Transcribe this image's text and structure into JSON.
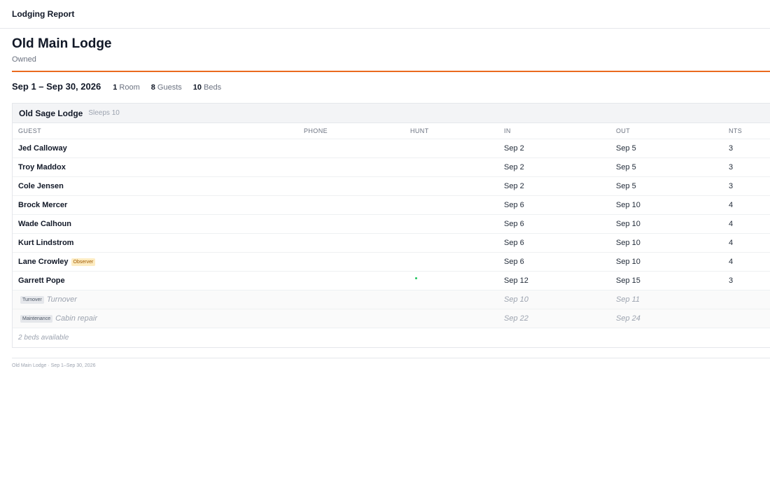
{
  "app": {
    "title": "Lodging Report"
  },
  "lodge": {
    "name": "Old Main Lodge",
    "ownership": "Owned"
  },
  "summary": {
    "dates": "Sep 1 – Sep 30, 2026",
    "rooms_count": "1",
    "rooms_label": "Room",
    "guests_count": "8",
    "guests_label": "Guests",
    "beds_count": "10",
    "beds_label": "Beds"
  },
  "room": {
    "name": "Old Sage Lodge",
    "sleeps": "Sleeps 10",
    "columns": {
      "guest": "GUEST",
      "phone": "PHONE",
      "hunt": "HUNT",
      "in": "IN",
      "out": "OUT",
      "nts": "NTS"
    },
    "guests": [
      {
        "name": "Jed Calloway",
        "phone": "",
        "hunt": "",
        "in": "Sep 2",
        "out": "Sep 5",
        "nts": "3"
      },
      {
        "name": "Troy Maddox",
        "phone": "",
        "hunt": "",
        "in": "Sep 2",
        "out": "Sep 5",
        "nts": "3"
      },
      {
        "name": "Cole Jensen",
        "phone": "",
        "hunt": "",
        "in": "Sep 2",
        "out": "Sep 5",
        "nts": "3"
      },
      {
        "name": "Brock Mercer",
        "phone": "",
        "hunt": "",
        "in": "Sep 6",
        "out": "Sep 10",
        "nts": "4"
      },
      {
        "name": "Wade Calhoun",
        "phone": "",
        "hunt": "",
        "in": "Sep 6",
        "out": "Sep 10",
        "nts": "4"
      },
      {
        "name": "Kurt Lindstrom",
        "phone": "",
        "hunt": "",
        "in": "Sep 6",
        "out": "Sep 10",
        "nts": "4"
      },
      {
        "name": "Lane Crowley",
        "badge": "Observer",
        "phone": "",
        "hunt": "",
        "in": "Sep 6",
        "out": "Sep 10",
        "nts": "4"
      },
      {
        "name": "Garrett Pope",
        "phone": "",
        "hunt": "",
        "in": "Sep 12",
        "out": "Sep 15",
        "nts": "3"
      }
    ],
    "blocks": [
      {
        "tag": "Turnover",
        "label": "Turnover",
        "in": "Sep 10",
        "out": "Sep 11"
      },
      {
        "tag": "Maintenance",
        "label": "Cabin repair",
        "in": "Sep 22",
        "out": "Sep 24"
      }
    ],
    "availability": "2 beds available"
  },
  "footer": {
    "text": "Old Main Lodge · Sep 1–Sep 30, 2026"
  },
  "colors": {
    "accent": "#ea6a1f",
    "observer_badge": "#fdecc2",
    "status_dot": "#22c55e"
  }
}
